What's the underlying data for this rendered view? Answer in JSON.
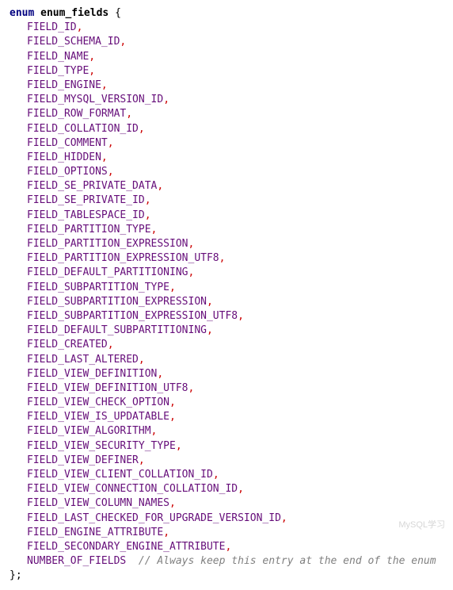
{
  "header": {
    "keyword": "enum",
    "name": "enum_fields",
    "open_brace": "{"
  },
  "fields": [
    "FIELD_ID",
    "FIELD_SCHEMA_ID",
    "FIELD_NAME",
    "FIELD_TYPE",
    "FIELD_ENGINE",
    "FIELD_MYSQL_VERSION_ID",
    "FIELD_ROW_FORMAT",
    "FIELD_COLLATION_ID",
    "FIELD_COMMENT",
    "FIELD_HIDDEN",
    "FIELD_OPTIONS",
    "FIELD_SE_PRIVATE_DATA",
    "FIELD_SE_PRIVATE_ID",
    "FIELD_TABLESPACE_ID",
    "FIELD_PARTITION_TYPE",
    "FIELD_PARTITION_EXPRESSION",
    "FIELD_PARTITION_EXPRESSION_UTF8",
    "FIELD_DEFAULT_PARTITIONING",
    "FIELD_SUBPARTITION_TYPE",
    "FIELD_SUBPARTITION_EXPRESSION",
    "FIELD_SUBPARTITION_EXPRESSION_UTF8",
    "FIELD_DEFAULT_SUBPARTITIONING",
    "FIELD_CREATED",
    "FIELD_LAST_ALTERED",
    "FIELD_VIEW_DEFINITION",
    "FIELD_VIEW_DEFINITION_UTF8",
    "FIELD_VIEW_CHECK_OPTION",
    "FIELD_VIEW_IS_UPDATABLE",
    "FIELD_VIEW_ALGORITHM",
    "FIELD_VIEW_SECURITY_TYPE",
    "FIELD_VIEW_DEFINER",
    "FIELD_VIEW_CLIENT_COLLATION_ID",
    "FIELD_VIEW_CONNECTION_COLLATION_ID",
    "FIELD_VIEW_COLUMN_NAMES",
    "FIELD_LAST_CHECKED_FOR_UPGRADE_VERSION_ID",
    "FIELD_ENGINE_ATTRIBUTE",
    "FIELD_SECONDARY_ENGINE_ATTRIBUTE"
  ],
  "last_field": {
    "name": "NUMBER_OF_FIELDS",
    "comment": "// Always keep this entry at the end of the enum"
  },
  "footer": {
    "close": "};"
  },
  "watermark": "MySQL学习"
}
